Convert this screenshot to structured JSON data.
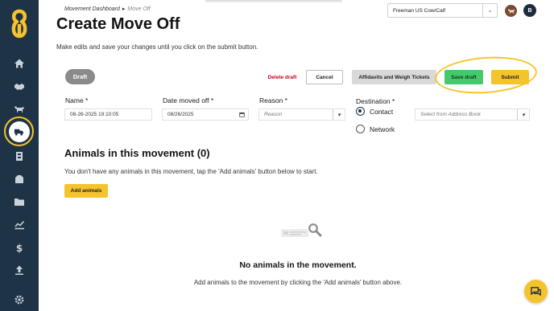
{
  "breadcrumb": {
    "parent": "Movement Dashboard",
    "separator": "▸",
    "current": "Move Off"
  },
  "page": {
    "title": "Create Move Off",
    "subtitle": "Make edits and save your changes until you click on the submit button."
  },
  "header": {
    "ranch_select_value": "Freeman US Cow/Calf",
    "user_initial": "B"
  },
  "status_badge": "Draft",
  "actions": {
    "delete_label": "Delete draft",
    "cancel_label": "Cancel",
    "affidavits_label": "Affidavits and Weigh Tickets",
    "save_label": "Save draft",
    "submit_label": "Submit"
  },
  "form": {
    "name_label": "Name *",
    "name_value": "08-26-2025 19:10:05",
    "date_label": "Date moved off *",
    "date_value": "08/26/2025",
    "reason_label": "Reason *",
    "reason_placeholder": "Reason",
    "destination_label": "Destination *",
    "destination_options": [
      "Contact",
      "Network"
    ],
    "destination_selected": "Contact",
    "address_placeholder": "Select from Address Book"
  },
  "animals": {
    "title": "Animals in this movement (0)",
    "hint": "You don't have any animals in this movement, tap the 'Add animals' button below to start.",
    "add_label": "Add animals",
    "empty_title": "No animals in the movement.",
    "empty_text": "Add animals to the movement by clicking the 'Add animals' button above."
  },
  "sidebar": {
    "items": [
      "home-icon",
      "handshake-icon",
      "cow-icon",
      "truck-icon",
      "building-icon",
      "barn-icon",
      "folder-icon",
      "chart-icon",
      "dollar-icon",
      "upload-icon",
      "settings-icon"
    ],
    "active": "truck-icon"
  },
  "colors": {
    "sidebar": "#1f3347",
    "accent_yellow": "#f5c42c",
    "save_green": "#46c96a",
    "delete_red": "#c4001a"
  }
}
